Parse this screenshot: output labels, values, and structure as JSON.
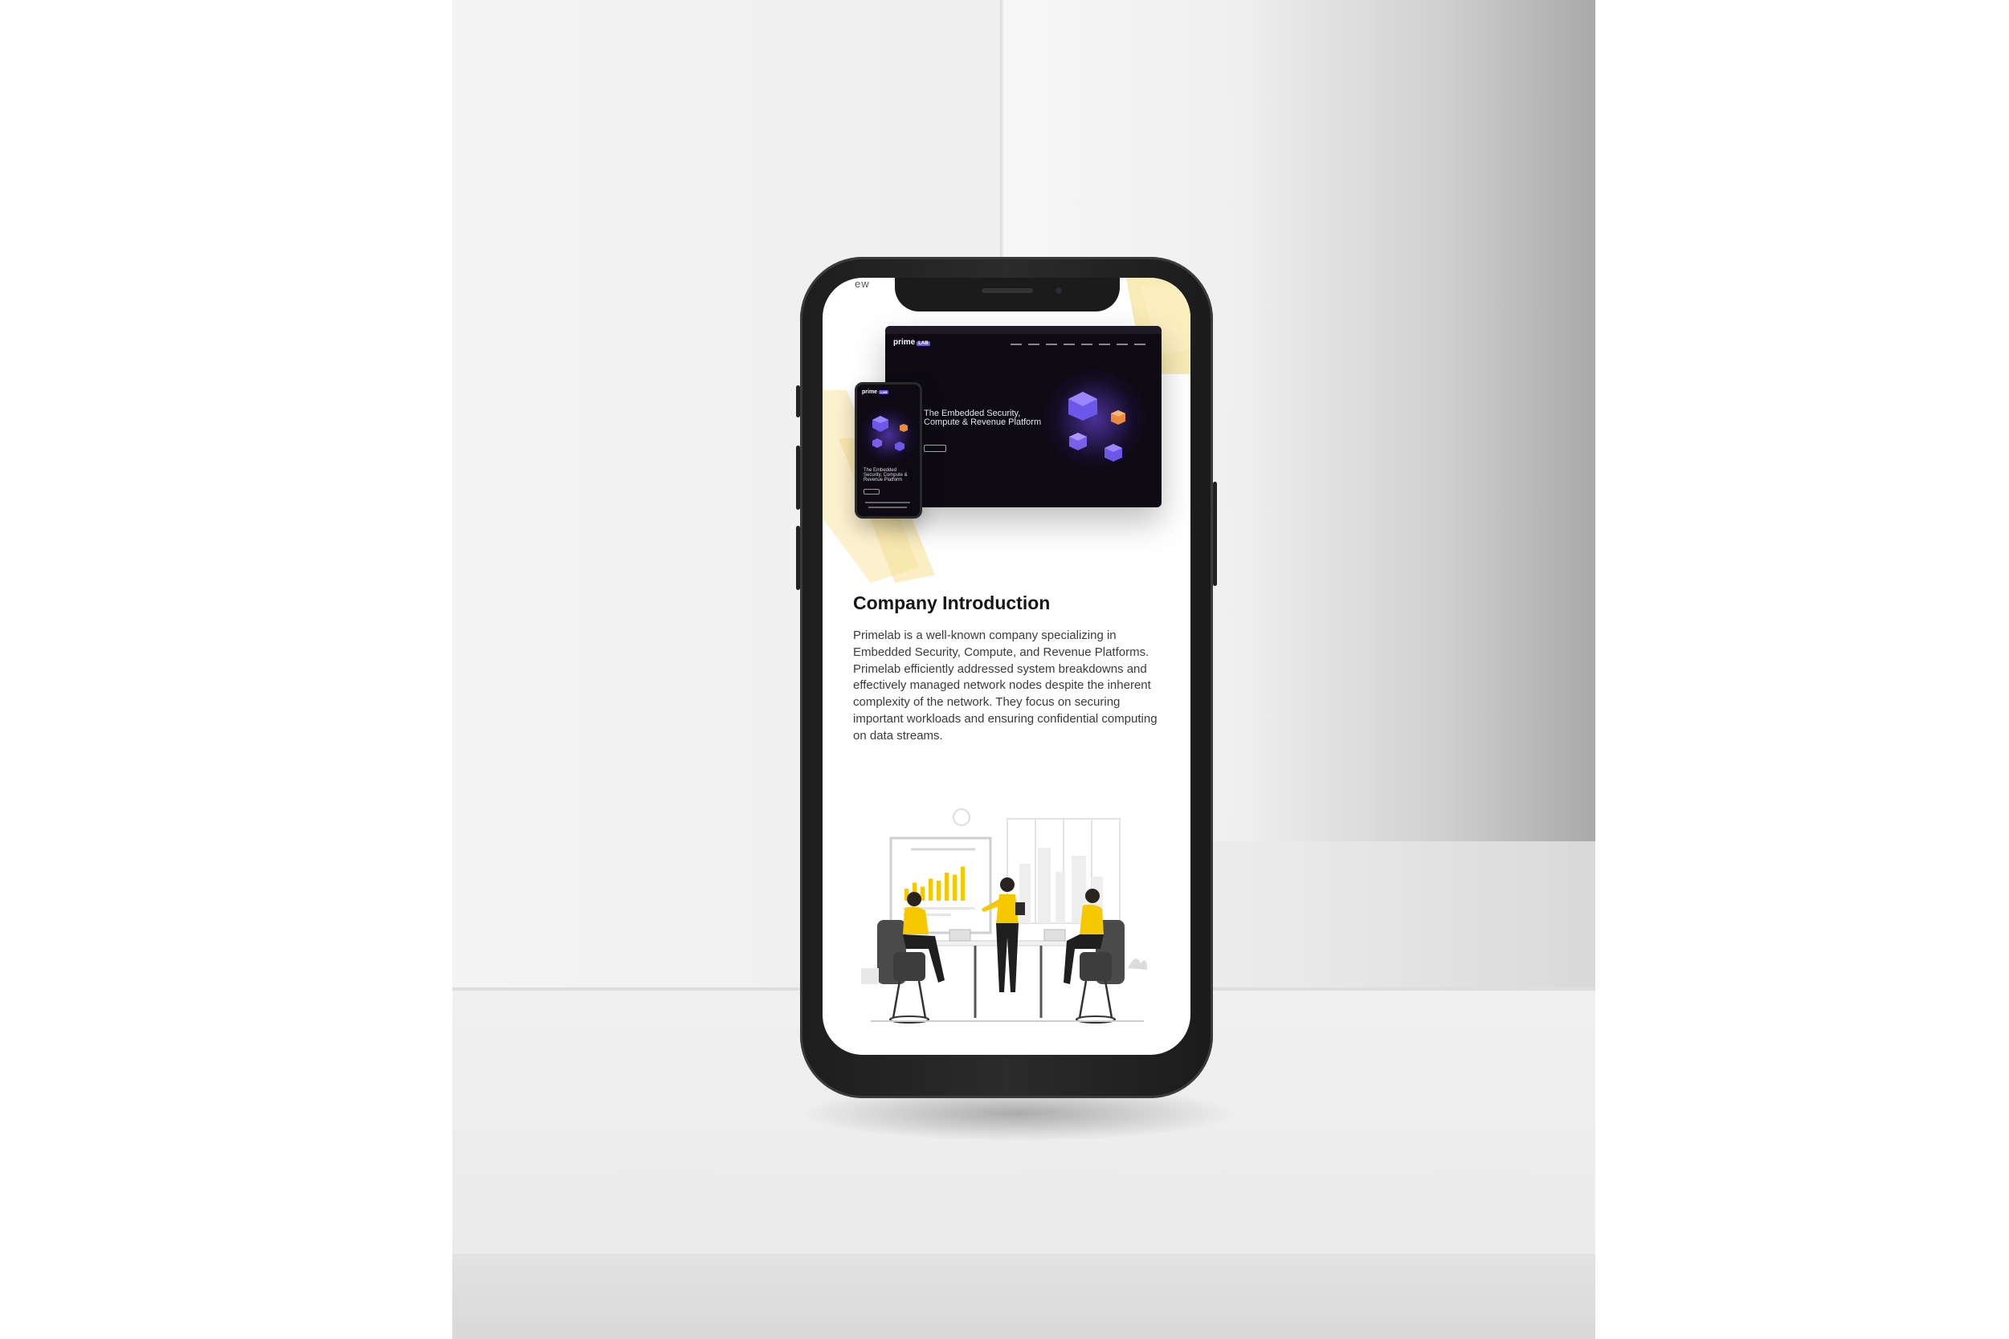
{
  "mockup_site": {
    "status_text": "ew",
    "laptop": {
      "logo_word": "prime",
      "logo_badge": "LAB",
      "hero_title": "The Embedded Security, Compute & Revenue Platform"
    },
    "mobile": {
      "logo_word": "prime",
      "logo_badge": "LAB",
      "hero_title": "The Embedded Security, Compute & Revenue Platform"
    },
    "section": {
      "heading": "Company Introduction",
      "body": "Primelab is a well-known company specializing in Embedded Security, Compute, and Revenue Platforms. Primelab efficiently addressed system breakdowns and effectively managed network nodes despite the inherent complexity of the network. They focus on securing important workloads and ensuring confidential computing on data streams."
    },
    "illustration": {
      "icon": "team-meeting-illustration",
      "bar_levels": [
        0.3,
        0.45,
        0.35,
        0.55,
        0.5,
        0.7,
        0.65,
        0.85
      ]
    }
  },
  "colors": {
    "accent_yellow": "#f5c800",
    "hero_purple": "#6d57e8",
    "dark_bg": "#0d0a14",
    "cube_orange": "#e98a3d"
  }
}
